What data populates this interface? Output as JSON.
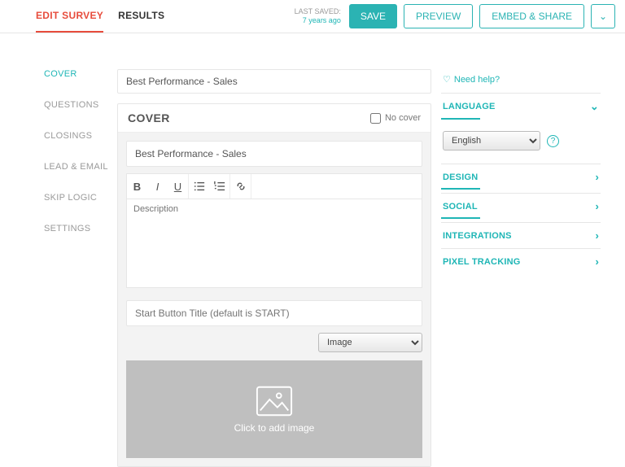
{
  "header": {
    "tabs": {
      "edit": "EDIT SURVEY",
      "results": "RESULTS"
    },
    "last_saved_label": "LAST SAVED:",
    "last_saved_ago": "7 years ago",
    "save": "SAVE",
    "preview": "PREVIEW",
    "embed": "EMBED & SHARE"
  },
  "sidebar": {
    "items": [
      "COVER",
      "QUESTIONS",
      "CLOSINGS",
      "LEAD & EMAIL",
      "SKIP LOGIC",
      "SETTINGS"
    ],
    "active_index": 0
  },
  "survey": {
    "title": "Best Performance - Sales",
    "section_heading": "COVER",
    "no_cover_label": "No cover",
    "no_cover_checked": false,
    "cover_title_value": "Best Performance - Sales",
    "description_placeholder": "Description",
    "start_button_placeholder": "Start Button Title (default is START)",
    "media_select": "Image",
    "image_drop_label": "Click to add image"
  },
  "right": {
    "need_help": "Need help?",
    "panels": {
      "language": "LANGUAGE",
      "language_value": "English",
      "design": "DESIGN",
      "social": "SOCIAL",
      "integrations": "INTEGRATIONS",
      "pixel": "PIXEL TRACKING"
    }
  }
}
